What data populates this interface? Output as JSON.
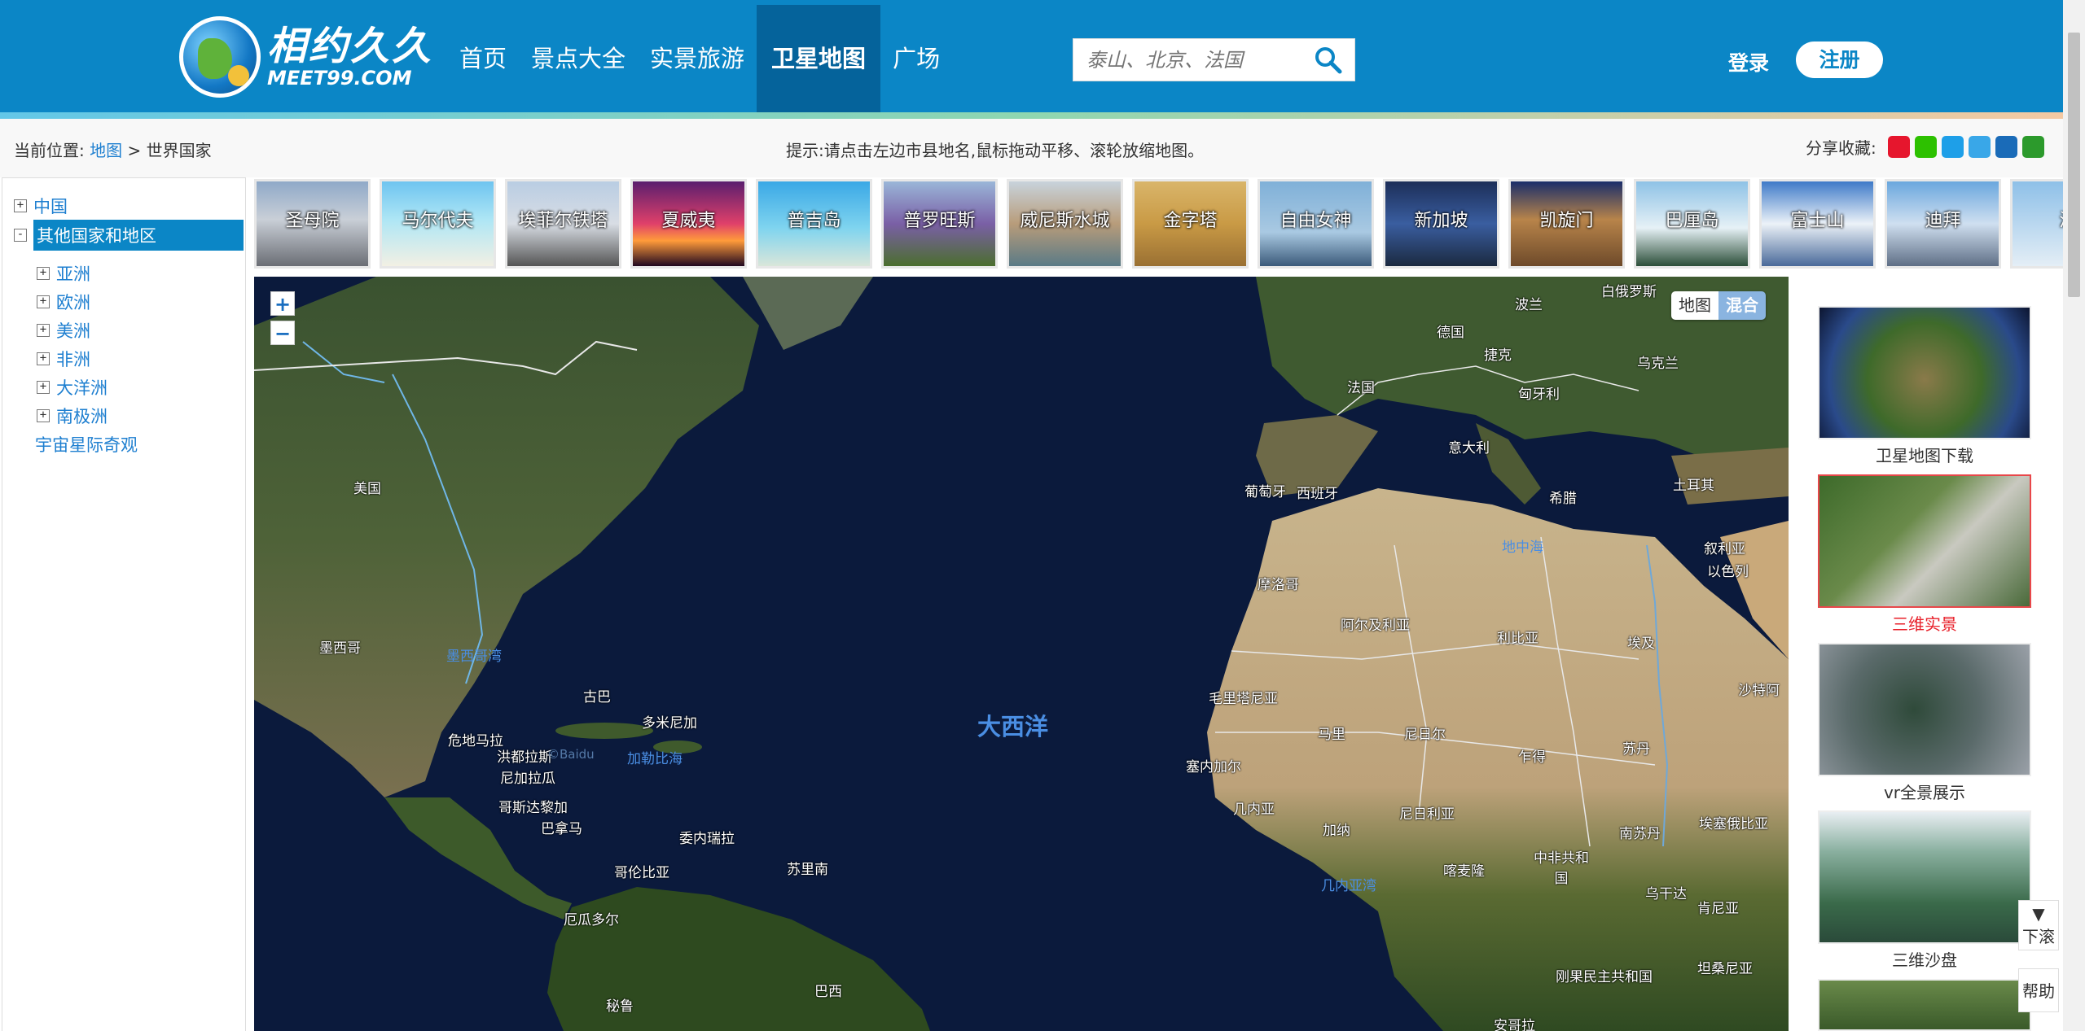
{
  "header": {
    "logo_cn": "相约久久",
    "logo_en": "MEET99.COM",
    "nav": [
      {
        "label": "首页"
      },
      {
        "label": "景点大全"
      },
      {
        "label": "实景旅游"
      },
      {
        "label": "卫星地图",
        "active": true
      },
      {
        "label": "广场"
      }
    ],
    "search": {
      "placeholder": "泰山、北京、法国"
    },
    "login": "登录",
    "register": "注册",
    "colors": {
      "bg": "#0b86c6",
      "active": "#05639b"
    }
  },
  "crumb": {
    "prefix": "当前位置:",
    "link": "地图",
    "sep": ">",
    "current": "世界国家"
  },
  "hint": "提示:请点击左边市县地名,鼠标拖动平移、滚轮放缩地图。",
  "share": {
    "label": "分享收藏:",
    "icons": [
      "weibo-icon",
      "wechat-icon",
      "favorite-icon",
      "qzone-icon",
      "renren-icon",
      "douban-icon"
    ]
  },
  "tree": [
    {
      "label": "中国",
      "toggle": "+",
      "level": 0
    },
    {
      "label": "其他国家和地区",
      "toggle": "-",
      "level": 0,
      "selected": true
    },
    {
      "label": "亚洲",
      "toggle": "+",
      "level": 1
    },
    {
      "label": "欧洲",
      "toggle": "+",
      "level": 1
    },
    {
      "label": "美洲",
      "toggle": "+",
      "level": 1
    },
    {
      "label": "非洲",
      "toggle": "+",
      "level": 1
    },
    {
      "label": "大洋洲",
      "toggle": "+",
      "level": 1
    },
    {
      "label": "南极洲",
      "toggle": "+",
      "level": 1
    },
    {
      "label": "宇宙星际奇观",
      "toggle": "",
      "level": 0
    }
  ],
  "thumbs": [
    "圣母院",
    "马尔代夫",
    "埃菲尔铁塔",
    "夏威夷",
    "普吉岛",
    "普罗旺斯",
    "威尼斯水城",
    "金字塔",
    "自由女神",
    "新加坡",
    "凯旋门",
    "巴厘岛",
    "富士山",
    "迪拜",
    "济"
  ],
  "map": {
    "zoom_in": "+",
    "zoom_out": "−",
    "type_map": "地图",
    "type_mix": "混合",
    "labels": {
      "usa": "美国",
      "mexico": "墨西哥",
      "gulf": "墨西哥湾",
      "cuba": "古巴",
      "dominica": "多米尼加",
      "guatemala": "危地马拉",
      "honduras": "洪都拉斯",
      "nicaragua": "尼加拉瓜",
      "costarica": "哥斯达黎加",
      "panama": "巴拿马",
      "caribbean": "加勒比海",
      "venezuela": "委内瑞拉",
      "suriname": "苏里南",
      "colombia": "哥伦比亚",
      "ecuador": "厄瓜多尔",
      "peru": "秘鲁",
      "brazil": "巴西",
      "atlantic": "大西洋",
      "baidu": "©Baidu",
      "belarus": "白俄罗斯",
      "poland": "波兰",
      "germany": "德国",
      "czech": "捷克",
      "ukraine": "乌克兰",
      "hungary": "匈牙利",
      "france": "法国",
      "italy": "意大利",
      "portugal": "葡萄牙",
      "spain": "西班牙",
      "greece": "希腊",
      "turkey": "土耳其",
      "med": "地中海",
      "syria": "叙利亚",
      "israel": "以色列",
      "morocco": "摩洛哥",
      "algeria": "阿尔及利亚",
      "libya": "利比亚",
      "egypt": "埃及",
      "saudi": "沙特阿",
      "mauritania": "毛里塔尼亚",
      "mali": "马里",
      "niger": "尼日尔",
      "chad": "乍得",
      "sudan": "苏丹",
      "senegal": "塞内加尔",
      "guinea": "几内亚",
      "ghana": "加纳",
      "nigeria": "尼日利亚",
      "cameroon": "喀麦隆",
      "car": "中非共和国",
      "southsudan": "南苏丹",
      "ethiopia": "埃塞俄比亚",
      "uganda": "乌干达",
      "kenya": "肯尼亚",
      "drc": "刚果民主共和国",
      "tanzania": "坦桑尼亚",
      "angola": "安哥拉",
      "gulfguinea": "几内亚湾"
    }
  },
  "right_panel": [
    {
      "caption": "卫星地图下载",
      "red": false
    },
    {
      "caption": "三维实景",
      "red": true
    },
    {
      "caption": "vr全景展示",
      "red": false
    },
    {
      "caption": "三维沙盘",
      "red": false
    }
  ],
  "float": {
    "down": "▼",
    "down_label": "下滚",
    "help": "帮助"
  }
}
